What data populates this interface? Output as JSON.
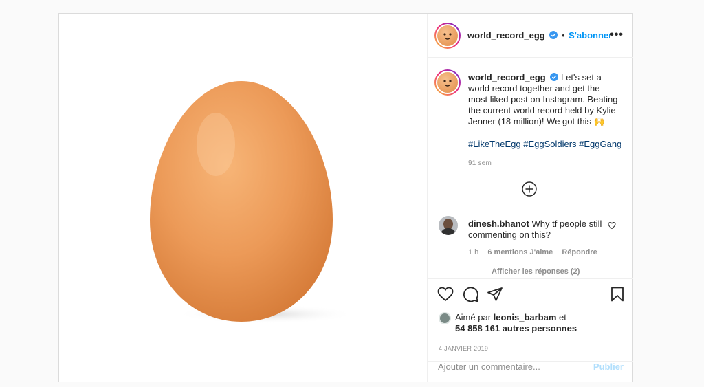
{
  "post": {
    "username": "world_record_egg",
    "follow_label": "S'abonner",
    "separator": "•",
    "more_label": "•••"
  },
  "caption": {
    "username": "world_record_egg",
    "text": "Let's set a world record together and get the most liked post on Instagram. Beating the current world record held by Kylie Jenner (18 million)! We got this 🙌",
    "hashtags": "#LikeTheEgg #EggSoldiers #EggGang",
    "time": "91 sem"
  },
  "comment": {
    "username": "dinesh.bhanot",
    "text": "Why tf people still commenting on this?",
    "time": "1 h",
    "likes": "6 mentions J'aime",
    "reply_label": "Répondre",
    "view_replies": "Afficher les réponses (2)"
  },
  "likes": {
    "prefix": "Aimé par",
    "user": "leonis_barbam",
    "and": "et",
    "others": "54 858 161 autres personnes"
  },
  "date": "4 JANVIER 2019",
  "add_comment": {
    "placeholder": "Ajouter un commentaire...",
    "publish_label": "Publier"
  },
  "colors": {
    "accent": "#0095f6",
    "hashtag": "#00376b",
    "egg": "#e8985a"
  },
  "icons": [
    "verified-icon",
    "more-options-icon",
    "load-more-icon",
    "heart-icon",
    "comment-icon",
    "share-icon",
    "save-icon",
    "comment-like-icon"
  ]
}
